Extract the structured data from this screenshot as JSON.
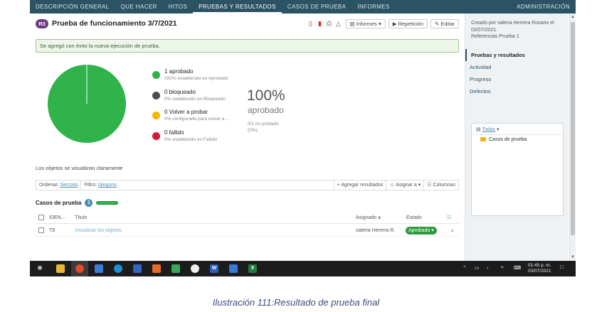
{
  "nav": {
    "items": [
      "DESCRIPCIÓN GENERAL",
      "QUE HACER",
      "HITOS",
      "PRUEBAS Y RESULTADOS",
      "CASOS DE PRUEBA",
      "INFORMES"
    ],
    "active_index": 3,
    "admin": "ADMINISTRACIÓN",
    "bar_color": "#2c5364"
  },
  "header": {
    "badge": "R3",
    "title": "Prueba de funcionamiento 3/7/2021",
    "informes_label": "Informes",
    "repeticion_label": "Repetición",
    "editar_label": "Editar"
  },
  "alert": {
    "text": "Se agregó con éxito la nueva ejecución de prueba."
  },
  "results": {
    "legend": [
      {
        "title": "1 aprobado",
        "sub": "100% establecido en Aprobado",
        "color": "#2fb34a"
      },
      {
        "title": "0 bloqueado",
        "sub": "0% establecido en Bloqueado",
        "color": "#4d4d4d"
      },
      {
        "title": "0 Volver a probar",
        "sub": "0% configurado para volver a ...",
        "color": "#f5b800"
      },
      {
        "title": "0 fallido",
        "sub": "0% establecido en Fallido",
        "color": "#d9163a"
      }
    ],
    "percent": "100%",
    "percent_label": "aprobado",
    "untested_line1": "0/1 no probado",
    "untested_line2": "(0%)."
  },
  "chart_data": {
    "type": "pie",
    "categories": [
      "Aprobado",
      "Bloqueado",
      "Volver a probar",
      "Fallido"
    ],
    "values": [
      1,
      0,
      0,
      0
    ],
    "colors": [
      "#2fb34a",
      "#4d4d4d",
      "#f5b800",
      "#d9163a"
    ]
  },
  "objects_note": "Los objetos se visualizan claramente",
  "filterbar": {
    "order_label": "Ordenar:",
    "order_value": "Sección",
    "filter_label": "Filtro:",
    "filter_value": "Ninguno",
    "add_results": "Agregar resultados",
    "assign": "Asignar a",
    "columns": "Columnas"
  },
  "cases": {
    "title": "Casos de prueba",
    "count": "1",
    "columns": {
      "id": "IDEN...",
      "title": "Título",
      "assigned": "Asignado a",
      "status": "Estado"
    },
    "rows": [
      {
        "id": "T9",
        "title": "Visualizar los objetos",
        "assigned": "valeria Herrera R.",
        "status": "Aprobado"
      }
    ]
  },
  "sidebar": {
    "meta": [
      "Creado por valeria Herrera Rosario el",
      "03/07/2021.",
      "Referencias Prueba 1"
    ],
    "menu": [
      "Pruebas y resultados",
      "Actividad",
      "Progreso",
      "Defectos"
    ],
    "active_index": 0,
    "box_filter": "Todas",
    "box_folder": "Casos de prueba"
  },
  "taskbar": {
    "time": "01:45 p. m.",
    "date": "03/07/2021"
  },
  "caption": "Ilustración 111:Resultado de prueba final"
}
